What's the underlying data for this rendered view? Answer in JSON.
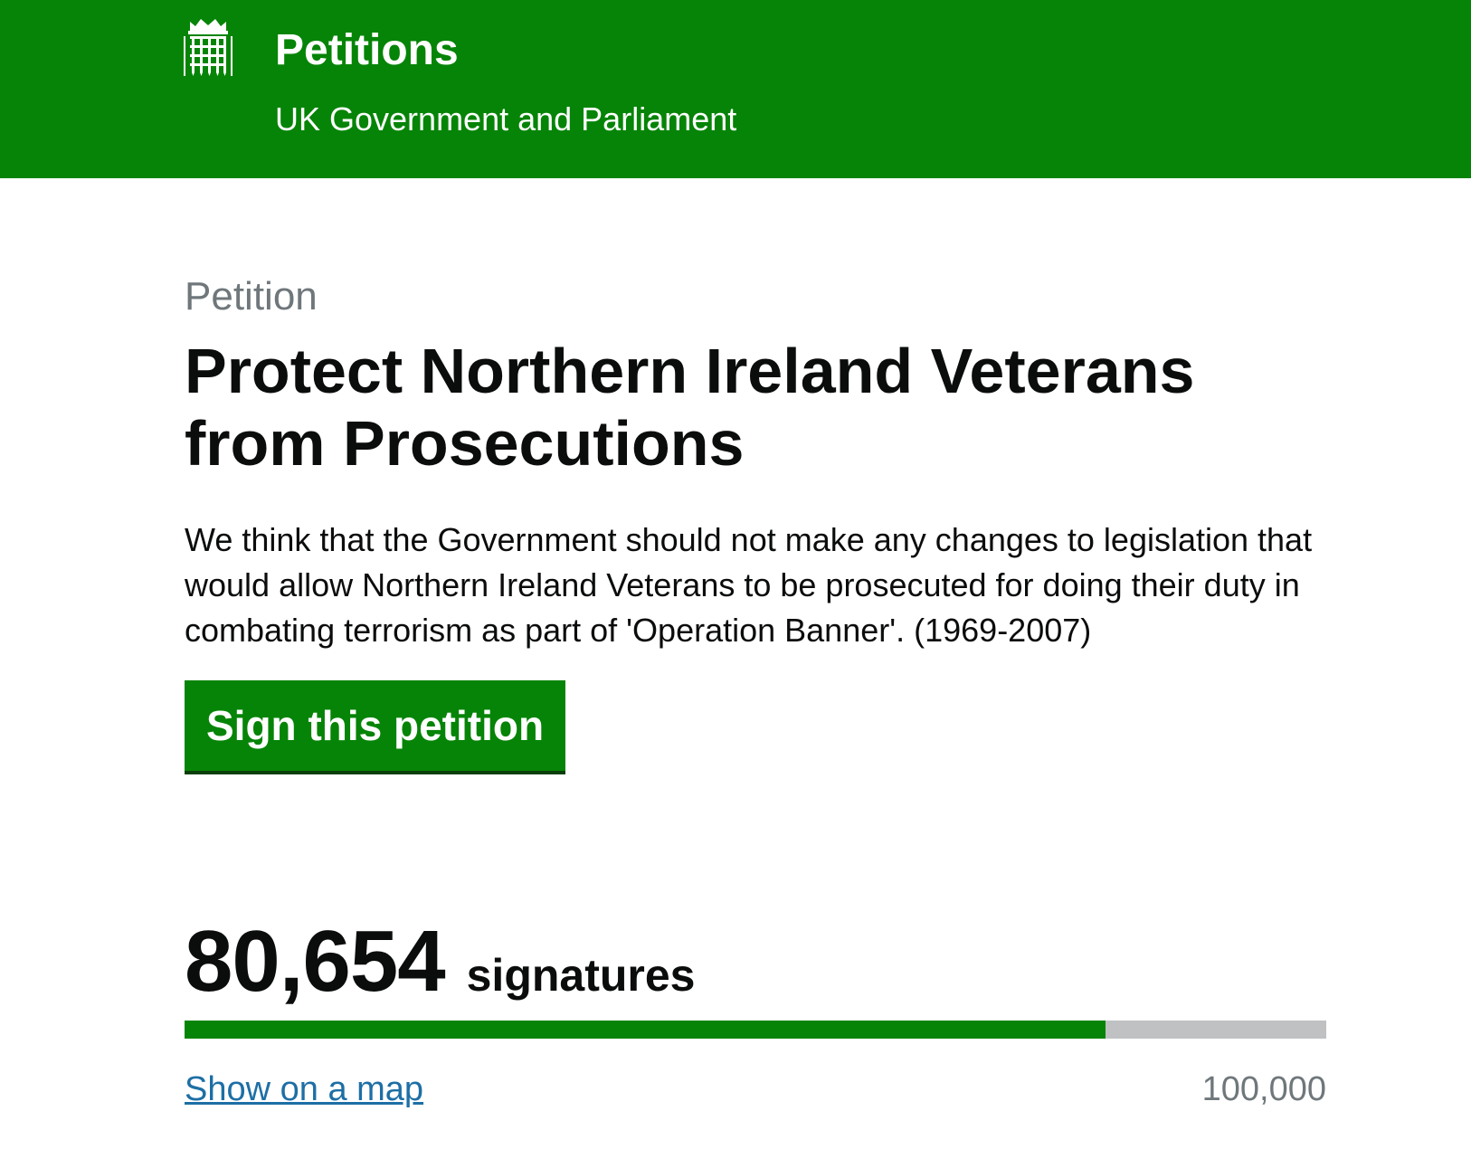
{
  "header": {
    "title": "Petitions",
    "subtitle": "UK Government and Parliament",
    "logo_icon": "portcullis-icon",
    "background_color": "#068407"
  },
  "petition": {
    "kicker": "Petition",
    "title": "Protect Northern Ireland Veterans from Prosecutions",
    "description": "We think that the Government should not make any changes to legislation that would allow Northern Ireland Veterans to be prosecuted for doing their duty in combating terrorism as part of 'Operation Banner'. (1969-2007)",
    "sign_button_label": "Sign this petition"
  },
  "signatures": {
    "count": "80,654",
    "label": "signatures",
    "progress_fraction": 0.80654,
    "map_link_label": "Show on a map",
    "threshold": "100,000"
  },
  "colors": {
    "brand_green": "#068407",
    "link_blue": "#1d6fa5",
    "secondary_text": "#6f777b",
    "progress_track": "#bfc1c3"
  }
}
